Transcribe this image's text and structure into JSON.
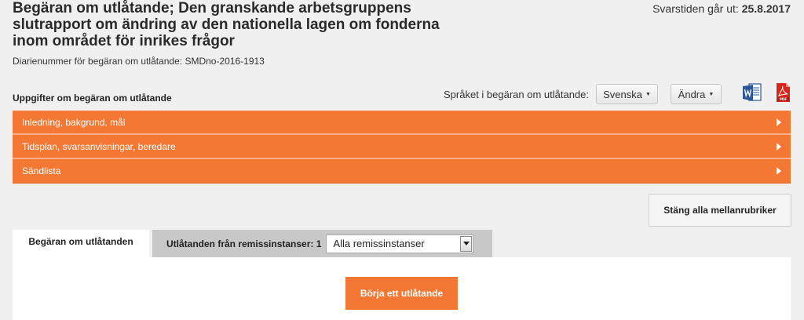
{
  "header": {
    "title": "Begäran om utlåtande; Den granskande arbetsgruppens slutrapport om ändring av den nationella lagen om fonderna inom området för inrikes frågor",
    "deadline_label": "Svarstiden går ut:",
    "deadline_value": "25.8.2017",
    "diary_number": "Diarienummer för begäran om utlåtande: SMDno-2016-1913"
  },
  "toolbar": {
    "section_label": "Uppgifter om begäran om utlåtande",
    "language_label": "Språket i begäran om utlåtande:",
    "language_button": "Svenska",
    "edit_button": "Ändra",
    "word_icon": "word-icon",
    "pdf_icon": "pdf-icon"
  },
  "accordion": {
    "items": [
      {
        "label": "Inledning, bakgrund, mål"
      },
      {
        "label": "Tidsplan, svarsanvisningar, beredare"
      },
      {
        "label": "Sändlista"
      }
    ]
  },
  "close_all_button": "Stäng alla mellanrubriker",
  "tabs": {
    "active": "Begäran om utlåtanden",
    "inactive": "Utlåtanden från remissinstanser: 1",
    "select_value": "Alla remissinstanser"
  },
  "panel": {
    "start_button": "Börja ett utlåtande"
  },
  "colors": {
    "accent": "#f47834",
    "background": "#f0f0f0",
    "tab_inactive": "#c8c8c8"
  }
}
